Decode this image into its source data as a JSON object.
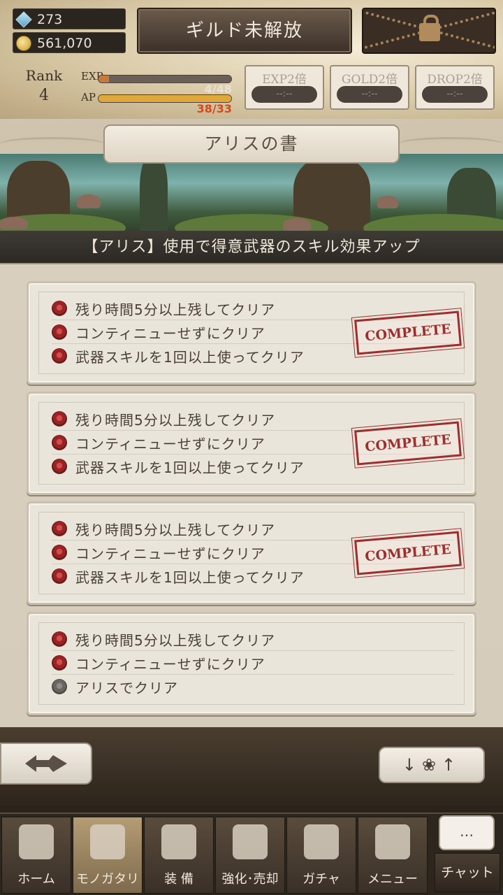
{
  "status": {
    "gems": "273",
    "gold": "561,070",
    "guild_button": "ギルド未解放",
    "rank_label": "Rank",
    "rank_value": "4",
    "exp_label": "EXP",
    "exp_value": "4/48",
    "exp_fraction": 0.08,
    "ap_label": "AP",
    "ap_value": "38/33",
    "ap_fraction": 1.0,
    "boosts": [
      {
        "label": "EXP2倍",
        "time": "--:--"
      },
      {
        "label": "GOLD2倍",
        "time": "--:--"
      },
      {
        "label": "DROP2倍",
        "time": "--:--"
      }
    ]
  },
  "book": {
    "title": "アリスの書",
    "subtitle": "【アリス】使用で得意武器のスキル効果アップ"
  },
  "missions": [
    {
      "complete": true,
      "stamp": "COMPLETE",
      "rows": [
        {
          "text": "残り時間5分以上残してクリア",
          "achieved": true
        },
        {
          "text": "コンティニューせずにクリア",
          "achieved": true
        },
        {
          "text": "武器スキルを1回以上使ってクリア",
          "achieved": true
        }
      ]
    },
    {
      "complete": true,
      "stamp": "COMPLETE",
      "rows": [
        {
          "text": "残り時間5分以上残してクリア",
          "achieved": true
        },
        {
          "text": "コンティニューせずにクリア",
          "achieved": true
        },
        {
          "text": "武器スキルを1回以上使ってクリア",
          "achieved": true
        }
      ]
    },
    {
      "complete": true,
      "stamp": "COMPLETE",
      "rows": [
        {
          "text": "残り時間5分以上残してクリア",
          "achieved": true
        },
        {
          "text": "コンティニューせずにクリア",
          "achieved": true
        },
        {
          "text": "武器スキルを1回以上使ってクリア",
          "achieved": true
        }
      ]
    },
    {
      "complete": false,
      "stamp": "",
      "rows": [
        {
          "text": "残り時間5分以上残してクリア",
          "achieved": true
        },
        {
          "text": "コンティニューせずにクリア",
          "achieved": true
        },
        {
          "text": "アリスでクリア",
          "achieved": false
        }
      ]
    }
  ],
  "controls": {
    "sort_label": "↓❀↑"
  },
  "tabs": [
    {
      "label": "ホーム",
      "icon": "castle-icon"
    },
    {
      "label": "モノガタリ",
      "icon": "book-icon",
      "active": true
    },
    {
      "label": "装 備",
      "icon": "puppet-icon"
    },
    {
      "label": "強化･売却",
      "icon": "helmet-icon"
    },
    {
      "label": "ガチャ",
      "icon": "crossed-swords-icon"
    },
    {
      "label": "メニュー",
      "icon": "gears-icon"
    }
  ],
  "chat": {
    "bubble": "…",
    "label": "チャット"
  },
  "colors": {
    "accent_red": "#9c2e2e",
    "exp_bar": "#c77a3b",
    "ap_bar": "#e0a83a"
  }
}
